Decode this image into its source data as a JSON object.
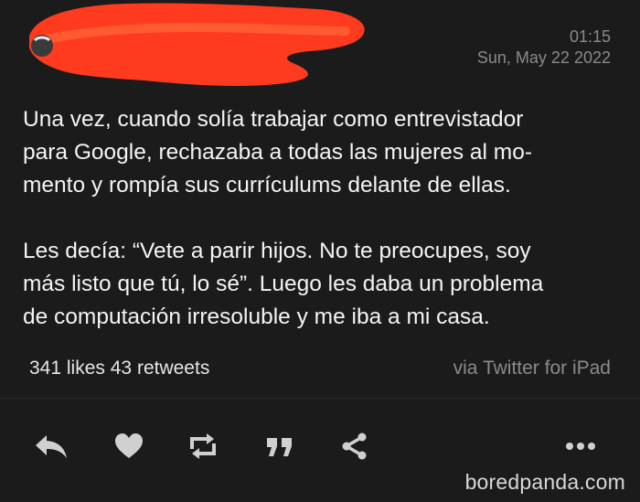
{
  "header": {
    "time": "01:15",
    "date": "Sun, May 22 2022",
    "redaction_color": "#ff3b1f"
  },
  "tweet": {
    "paragraphs": [
      "Una vez, cuando solía trabajar como entrevistador\npara Google, rechazaba a todas las mujeres al mo-\nmento y rompía sus currículums delante de ellas.",
      "Les decía: “Vete a parir hijos. No te preocupes, soy\nmás listo que tú, lo sé”. Luego les daba un problema\nde computación irresoluble y me iba a mi casa."
    ]
  },
  "stats": {
    "likes_count": "341",
    "likes_label": "likes",
    "retweets_count": "43",
    "retweets_label": "retweets",
    "via": "via Twitter for iPad"
  },
  "actions": {
    "icons": [
      "reply-icon",
      "like-icon",
      "retweet-icon",
      "quote-icon",
      "share-icon",
      "more-icon"
    ],
    "color": "#d0d0d0"
  },
  "watermark": "boredpanda.com"
}
